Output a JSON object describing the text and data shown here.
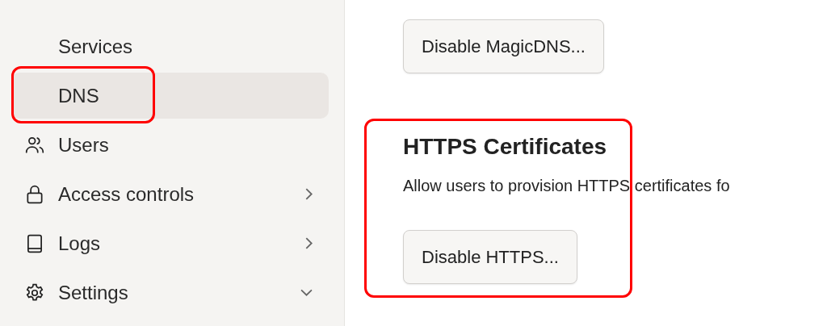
{
  "sidebar": {
    "items": [
      {
        "label": "Services",
        "expandable": false,
        "expanded": false,
        "selected": false,
        "highlighted": false
      },
      {
        "label": "DNS",
        "expandable": false,
        "expanded": false,
        "selected": true,
        "highlighted": true
      },
      {
        "label": "Users",
        "expandable": false,
        "expanded": false,
        "selected": false,
        "highlighted": false
      },
      {
        "label": "Access controls",
        "expandable": true,
        "expanded": false,
        "selected": false,
        "highlighted": false
      },
      {
        "label": "Logs",
        "expandable": true,
        "expanded": false,
        "selected": false,
        "highlighted": false
      },
      {
        "label": "Settings",
        "expandable": true,
        "expanded": true,
        "selected": false,
        "highlighted": false
      }
    ]
  },
  "main": {
    "magicdns_button": "Disable MagicDNS...",
    "https_section": {
      "title": "HTTPS Certificates",
      "description": "Allow users to provision HTTPS certificates fo",
      "button": "Disable HTTPS...",
      "highlighted": true
    }
  }
}
